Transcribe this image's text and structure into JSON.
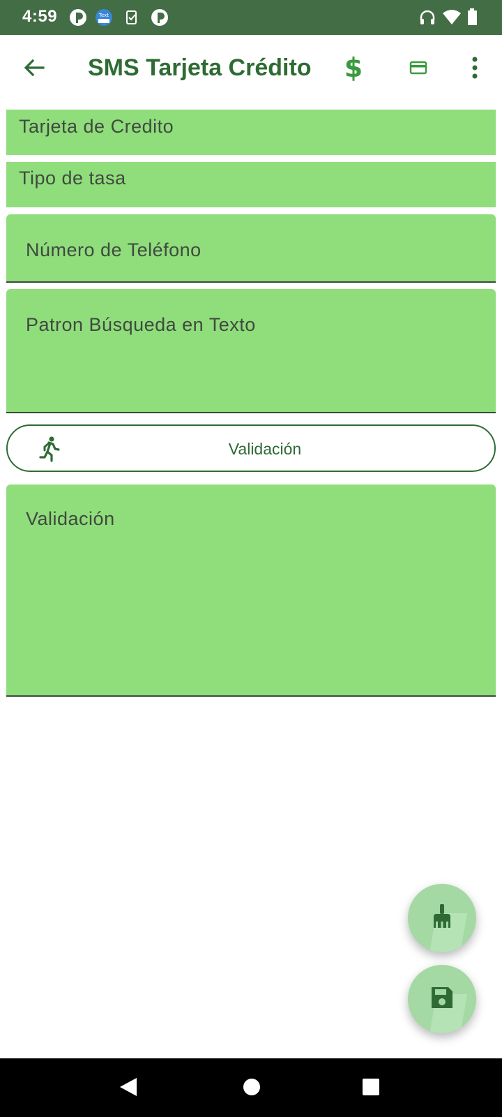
{
  "status_bar": {
    "time": "4:59",
    "left_icons": [
      "pinterest-like-icon",
      "text-app-icon",
      "clipboard-check-icon",
      "pinterest-like-icon"
    ],
    "right_icons": [
      "headphones-icon",
      "wifi-icon",
      "battery-icon"
    ]
  },
  "app_bar": {
    "back_icon": "arrow-back-icon",
    "title": "SMS Tarjeta Crédito",
    "actions": [
      "dollar-icon",
      "credit-card-icon",
      "more-vert-icon"
    ]
  },
  "form": {
    "card_label": "Tarjeta de Credito",
    "rate_type_label": "Tipo de tasa",
    "phone_label": "Número de Teléfono",
    "pattern_label": "Patron Búsqueda en Texto",
    "validate_button_label": "Validación",
    "validate_button_icon": "run-icon",
    "validation_label": "Validación"
  },
  "fabs": {
    "clean_icon": "broom-icon",
    "save_icon": "save-icon"
  },
  "colors": {
    "status_bar": "#436d45",
    "accent": "#2e6b33",
    "field_bg": "#90dd7c",
    "fab_bg": "#a4d9a4"
  }
}
